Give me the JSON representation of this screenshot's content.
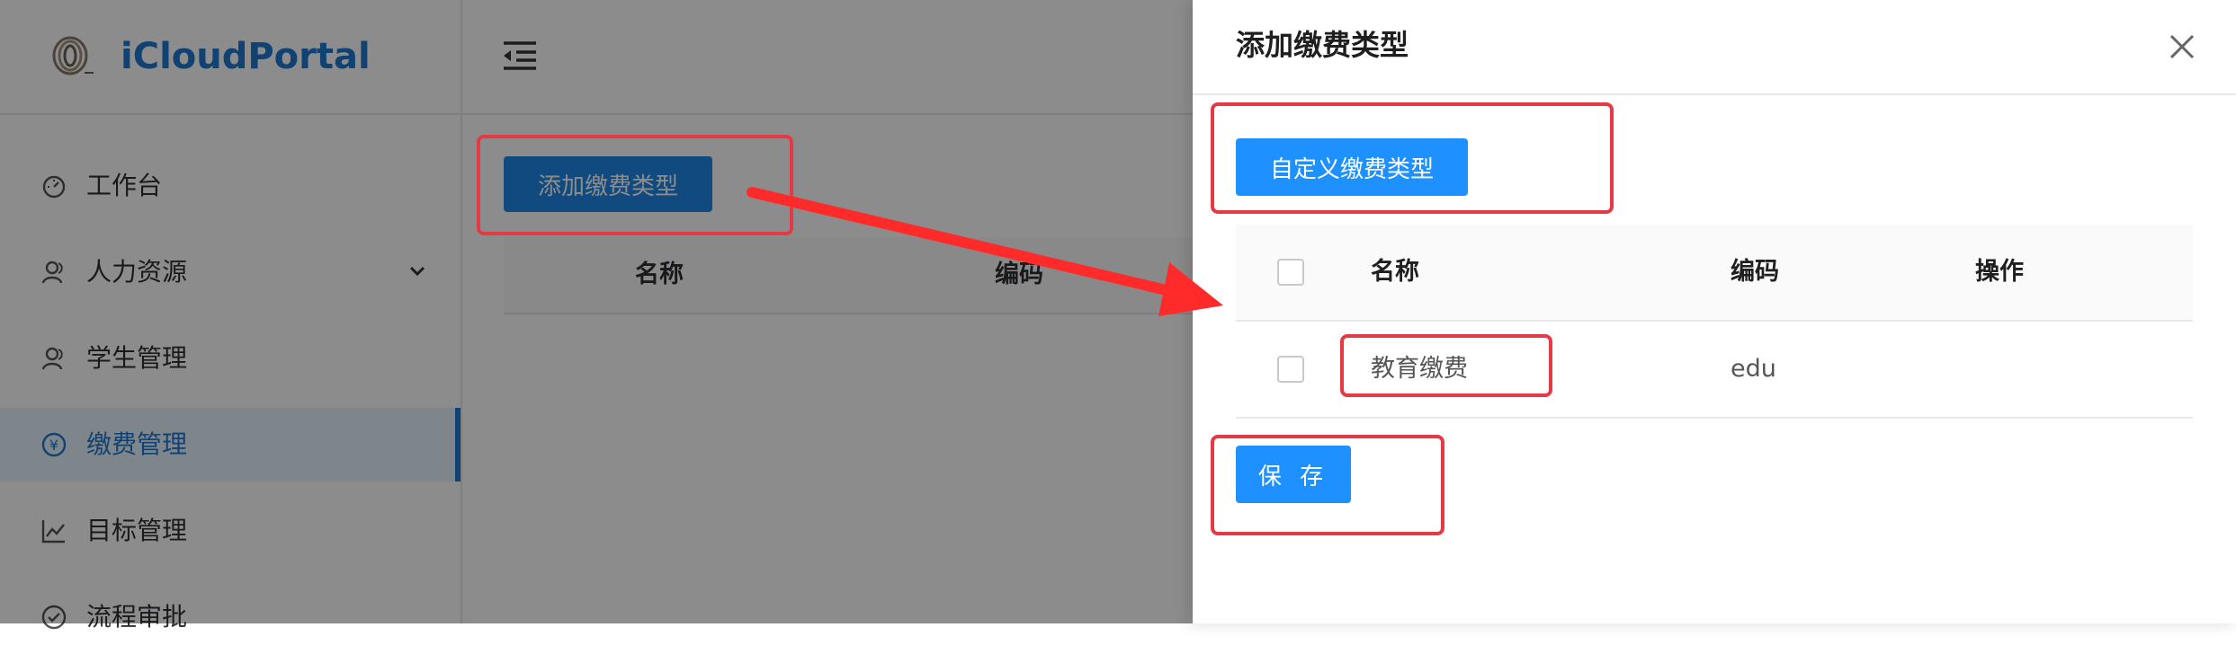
{
  "app": {
    "brand": "iCloudPortal",
    "sidebar": {
      "items": [
        {
          "label": "工作台",
          "icon": "dashboard-icon"
        },
        {
          "label": "人力资源",
          "icon": "user-icon",
          "has_submenu": true
        },
        {
          "label": "学生管理",
          "icon": "user-icon"
        },
        {
          "label": "缴费管理",
          "icon": "yen-circle-icon",
          "active": true
        },
        {
          "label": "目标管理",
          "icon": "chart-line-icon"
        },
        {
          "label": "流程审批",
          "icon": "check-circle-icon"
        }
      ]
    },
    "content": {
      "add_button_label": "添加缴费类型",
      "table_headers": [
        "名称",
        "编码"
      ]
    }
  },
  "drawer": {
    "title": "添加缴费类型",
    "custom_button_label": "自定义缴费类型",
    "table": {
      "headers": [
        "名称",
        "编码",
        "操作"
      ],
      "rows": [
        {
          "name": "教育缴费",
          "code": "edu",
          "checked": false
        }
      ]
    },
    "save_button_label": "保 存"
  },
  "colors": {
    "brand": "#1e78d2",
    "primary_button": "#1e90ff",
    "annotation": "#e63946"
  }
}
